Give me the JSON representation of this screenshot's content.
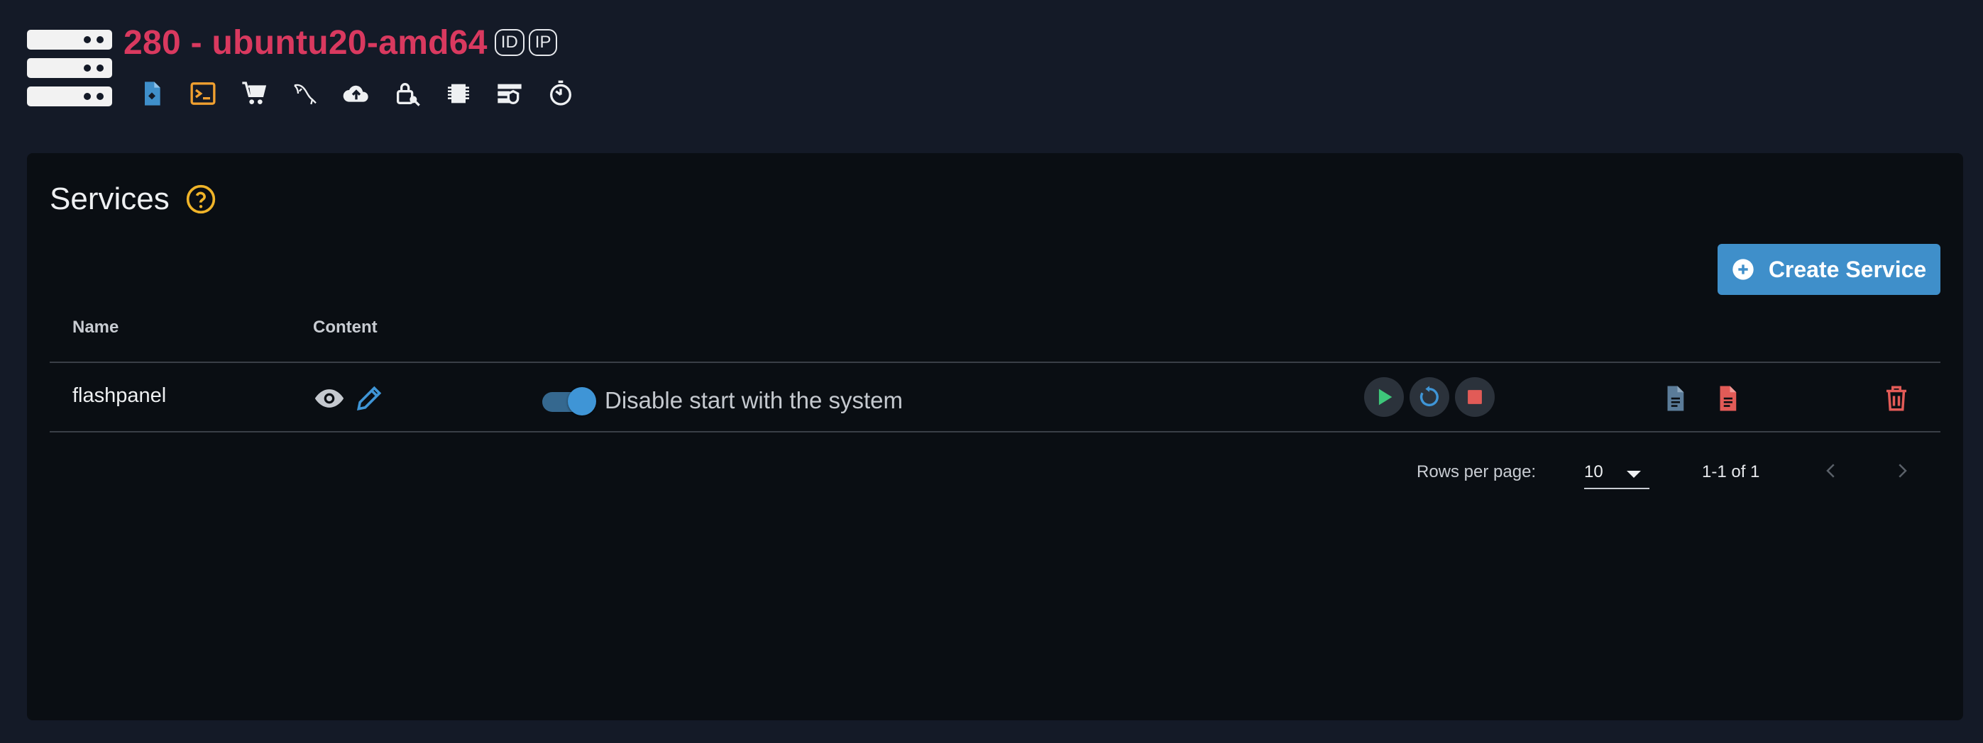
{
  "header": {
    "title": "280 - ubuntu20-amd64",
    "chips": [
      "ID",
      "IP"
    ],
    "colors": {
      "title": "#d9395f",
      "background": "#141a27"
    },
    "toolbar_icons": [
      {
        "name": "file-browser-icon",
        "color": "#3f8fca"
      },
      {
        "name": "terminal-icon",
        "color": "#f0a030"
      },
      {
        "name": "cart-icon",
        "color": "#eef0f2"
      },
      {
        "name": "mysql-dolphin-icon",
        "color": "#eef0f2"
      },
      {
        "name": "cloud-upload-icon",
        "color": "#eef0f2"
      },
      {
        "name": "lock-key-icon",
        "color": "#eef0f2"
      },
      {
        "name": "memory-chip-icon",
        "color": "#eef0f2"
      },
      {
        "name": "firewall-icon",
        "color": "#eef0f2"
      },
      {
        "name": "timer-icon",
        "color": "#eef0f2"
      }
    ]
  },
  "services": {
    "title": "Services",
    "help_icon": "question-circle-icon",
    "create_button_label": "Create Service",
    "columns": {
      "name": "Name",
      "content": "Content"
    },
    "rows": [
      {
        "name": "flashpanel",
        "startup_toggle_on": true,
        "startup_toggle_label": "Disable start with the system",
        "actions": [
          "play-icon",
          "restart-icon",
          "stop-icon"
        ],
        "logs": [
          "log-file-icon",
          "error-log-icon"
        ]
      }
    ],
    "pagination": {
      "rows_per_page_label": "Rows per page:",
      "rows_per_page_value": "10",
      "range_text": "1-1 of 1"
    },
    "colors": {
      "accent": "#3f8fca",
      "danger": "#e25b57",
      "success": "#3ec77a"
    }
  }
}
